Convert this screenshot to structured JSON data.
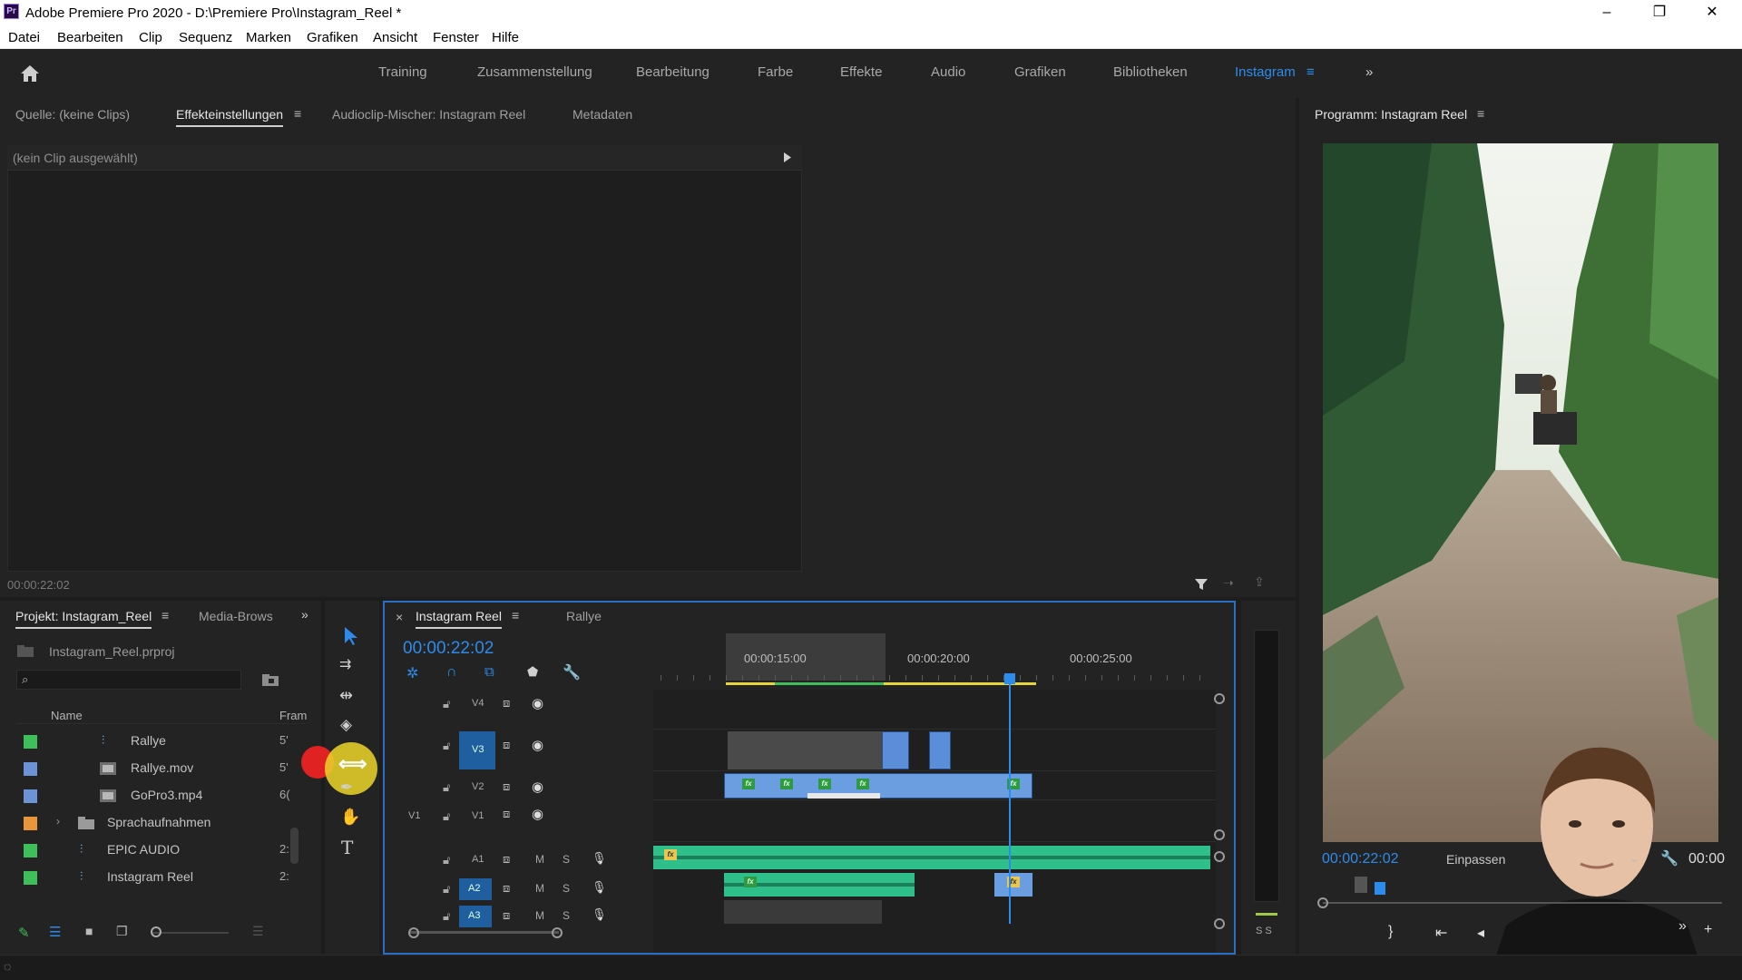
{
  "window": {
    "title": "Adobe Premiere Pro 2020 - D:\\Premiere Pro\\Instagram_Reel *",
    "app_icon": "Pr",
    "minimize": "–",
    "maximize": "❐",
    "close": "✕"
  },
  "menu": [
    "Datei",
    "Bearbeiten",
    "Clip",
    "Sequenz",
    "Marken",
    "Grafiken",
    "Ansicht",
    "Fenster",
    "Hilfe"
  ],
  "workspaces": {
    "items": [
      "Training",
      "Zusammenstellung",
      "Bearbeitung",
      "Farbe",
      "Effekte",
      "Audio",
      "Grafiken",
      "Bibliotheken",
      "Instagram"
    ],
    "active": "Instagram",
    "overflow": "»"
  },
  "effects_panel": {
    "tabs": [
      "Quelle: (keine Clips)",
      "Effekteinstellungen",
      "Audioclip-Mischer: Instagram Reel",
      "Metadaten"
    ],
    "active_tab": "Effekteinstellungen",
    "no_clip": "(kein Clip ausgewählt)",
    "timecode": "00:00:22:02"
  },
  "project_panel": {
    "tabs": [
      "Projekt: Instagram_Reel",
      "Media-Brows"
    ],
    "file": "Instagram_Reel.prproj",
    "search_placeholder": "",
    "col_name": "Name",
    "col_frame": "Fram",
    "items": [
      {
        "name": "Rallye",
        "type": "sequence",
        "color": "#3fbf5a",
        "extra": "5'"
      },
      {
        "name": "Rallye.mov",
        "type": "video",
        "color": "#6b93d6",
        "extra": "5'"
      },
      {
        "name": "GoPro3.mp4",
        "type": "video",
        "color": "#6b93d6",
        "extra": "6("
      },
      {
        "name": "Sprachaufnahmen",
        "type": "folder",
        "color": "#e8963c",
        "extra": ""
      },
      {
        "name": "EPIC AUDIO",
        "type": "sequence",
        "color": "#3fbf5a",
        "extra": "2:"
      },
      {
        "name": "Instagram Reel",
        "type": "sequence",
        "color": "#3fbf5a",
        "extra": "2:"
      }
    ]
  },
  "timeline": {
    "tabs": [
      "Instagram Reel",
      "Rallye"
    ],
    "close": "×",
    "timecode": "00:00:22:02",
    "ruler": [
      "00:00:15:00",
      "00:00:20:00",
      "00:00:25:00"
    ],
    "video_tracks": [
      "V4",
      "V3",
      "V2",
      "V1"
    ],
    "audio_tracks": [
      "A1",
      "A2",
      "A3"
    ],
    "source_patch": "V1",
    "mute": "M",
    "solo": "S",
    "meter_labels": "S S"
  },
  "program_monitor": {
    "title": "Programm: Instagram Reel",
    "timecode": "00:00:22:02",
    "fit": "Einpassen",
    "duration": "00:00"
  }
}
